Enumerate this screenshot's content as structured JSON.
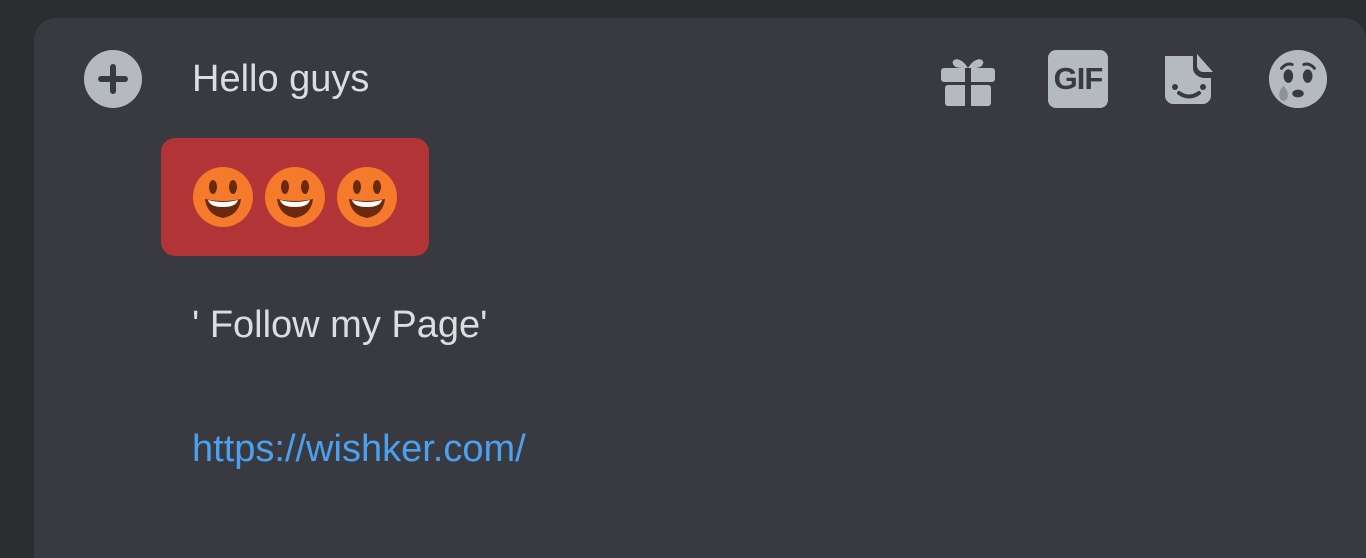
{
  "composer": {
    "message_lines": {
      "greeting": "Hello guys",
      "follow": "' Follow my Page'",
      "link": "https://wishker.com/"
    },
    "emoji_count": 3
  },
  "toolbar": {
    "add_icon": "plus-circle-icon",
    "gift_icon": "gift-icon",
    "gif_label": "GIF",
    "sticker_icon": "sticker-icon",
    "emoji_icon": "emoji-face-icon"
  },
  "colors": {
    "background": "#2b2d31",
    "composer": "#383a40",
    "text": "#dbdee1",
    "icon": "#b5bac1",
    "link": "#4ba1f0",
    "emoji_highlight": "#b33437",
    "emoji_fill": "#f57a2b"
  }
}
